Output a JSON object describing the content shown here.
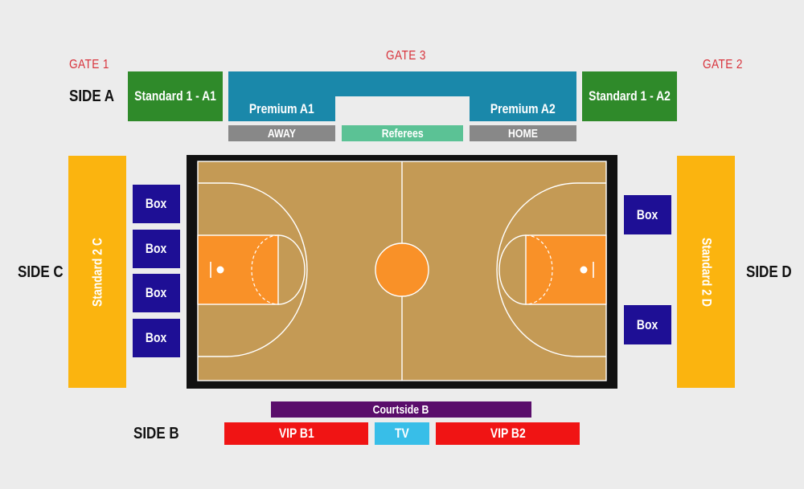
{
  "gates": {
    "gate1": "GATE 1",
    "gate2": "GATE 2",
    "gate3": "GATE 3"
  },
  "sides": {
    "a": "SIDE A",
    "b": "SIDE B",
    "c": "SIDE C",
    "d": "SIDE D"
  },
  "sections": {
    "standard_a1": "Standard 1 - A1",
    "standard_a2": "Standard 1 - A2",
    "premium_a1": "Premium A1",
    "premium_a2": "Premium A2",
    "away": "AWAY",
    "referees": "Referees",
    "home": "HOME",
    "standard_2c": "Standard 2 C",
    "standard_2d": "Standard 2 D",
    "box": "Box",
    "courtside_b": "Courtside B",
    "vip_b1": "VIP B1",
    "tv": "TV",
    "vip_b2": "VIP B2"
  },
  "colors": {
    "standard": "#2f8a2a",
    "premium": "#1a88aa",
    "bench": "#888888",
    "referees": "#5bc295",
    "standard2": "#fbb40f",
    "box": "#1e0f95",
    "courtside": "#5a0d6b",
    "vip": "#f01414",
    "tv": "#38bee8",
    "court_floor": "#c49a55",
    "paint": "#f99128",
    "gate_text": "#d8323b"
  }
}
